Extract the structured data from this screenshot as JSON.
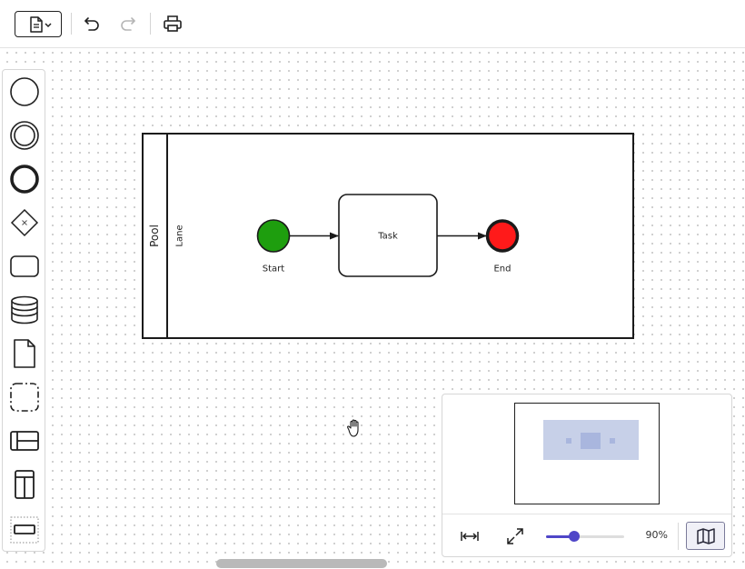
{
  "toolbar": {
    "buttons": [
      {
        "name": "file-menu",
        "icon": "document-icon"
      },
      {
        "name": "undo",
        "icon": "undo-icon"
      },
      {
        "name": "redo",
        "icon": "redo-icon",
        "disabled": true
      },
      {
        "name": "print",
        "icon": "printer-icon"
      }
    ]
  },
  "palette": {
    "items": [
      "start-event-icon",
      "intermediate-event-icon",
      "end-event-icon",
      "gateway-icon",
      "task-icon",
      "data-store-icon",
      "data-object-icon",
      "group-icon",
      "pool-horizontal-icon",
      "pool-vertical-icon",
      "lane-icon"
    ]
  },
  "diagram": {
    "pool_label": "Pool",
    "lane_label": "Lane",
    "start_label": "Start",
    "task_label": "Task",
    "end_label": "End",
    "colors": {
      "start_fill": "#1e9e0e",
      "end_fill": "#ff1a1a",
      "stroke": "#1a1a1a"
    }
  },
  "minimap": {
    "zoom": 90,
    "zoom_text": "90%",
    "colors": {
      "accent": "#4f46c8"
    }
  }
}
